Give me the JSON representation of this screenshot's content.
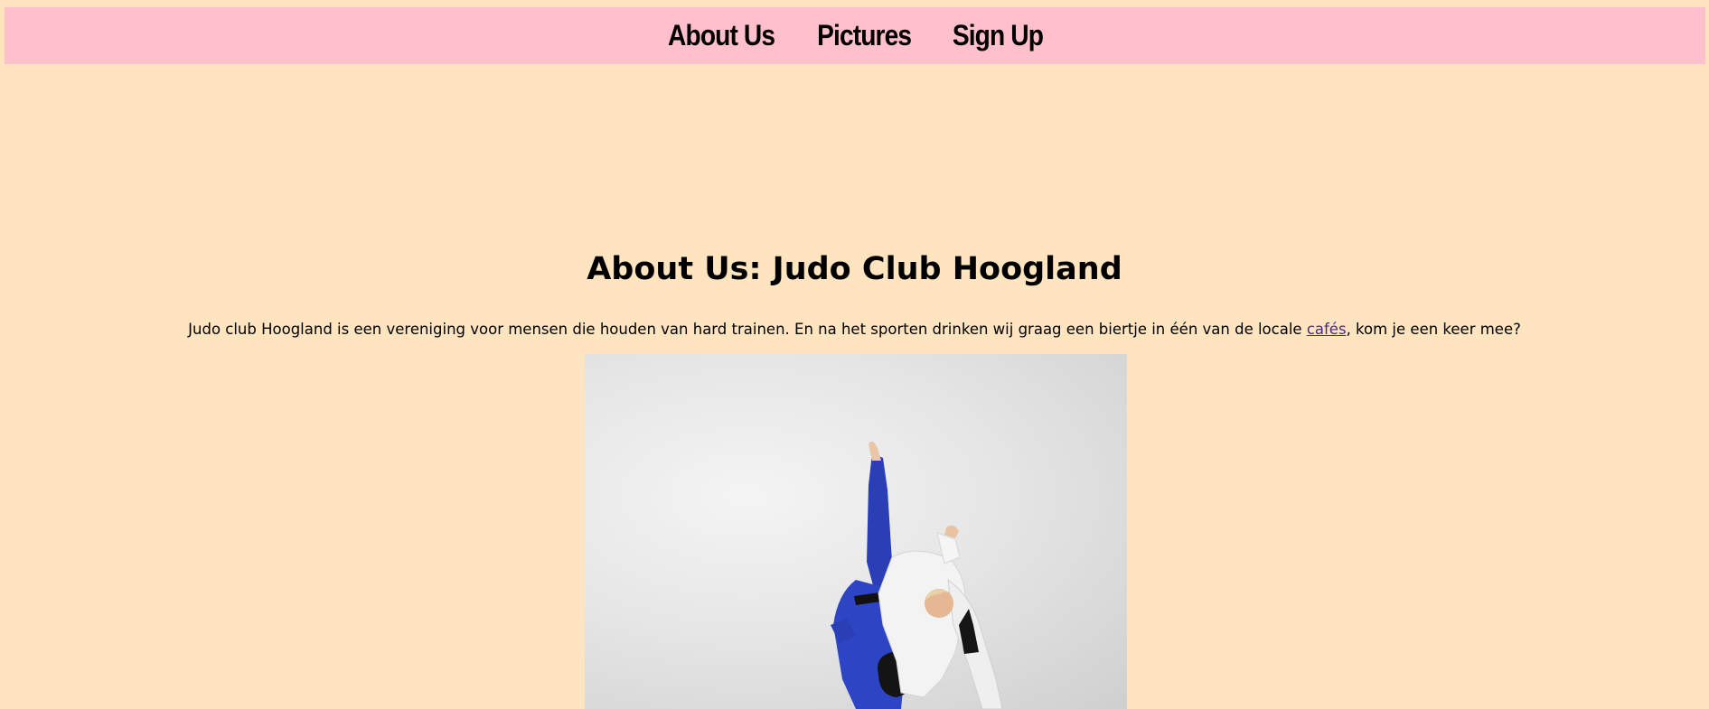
{
  "nav": {
    "items": [
      {
        "label": "About Us"
      },
      {
        "label": "Pictures"
      },
      {
        "label": "Sign Up"
      }
    ]
  },
  "main": {
    "title": "About Us: Judo Club Hoogland",
    "intro_before_link": "Judo club Hoogland is een vereniging voor mensen die houden van hard trainen. En na het sporten drinken wij graag een biertje in één van de locale ",
    "intro_link": "cafés",
    "intro_after_link": ", kom je een keer mee?"
  },
  "photo": {
    "subject": "judo-throw-photo"
  },
  "colors": {
    "page_background": "#ffe4c0",
    "nav_background": "#ffc0cb",
    "link": "#4b2a8a"
  }
}
